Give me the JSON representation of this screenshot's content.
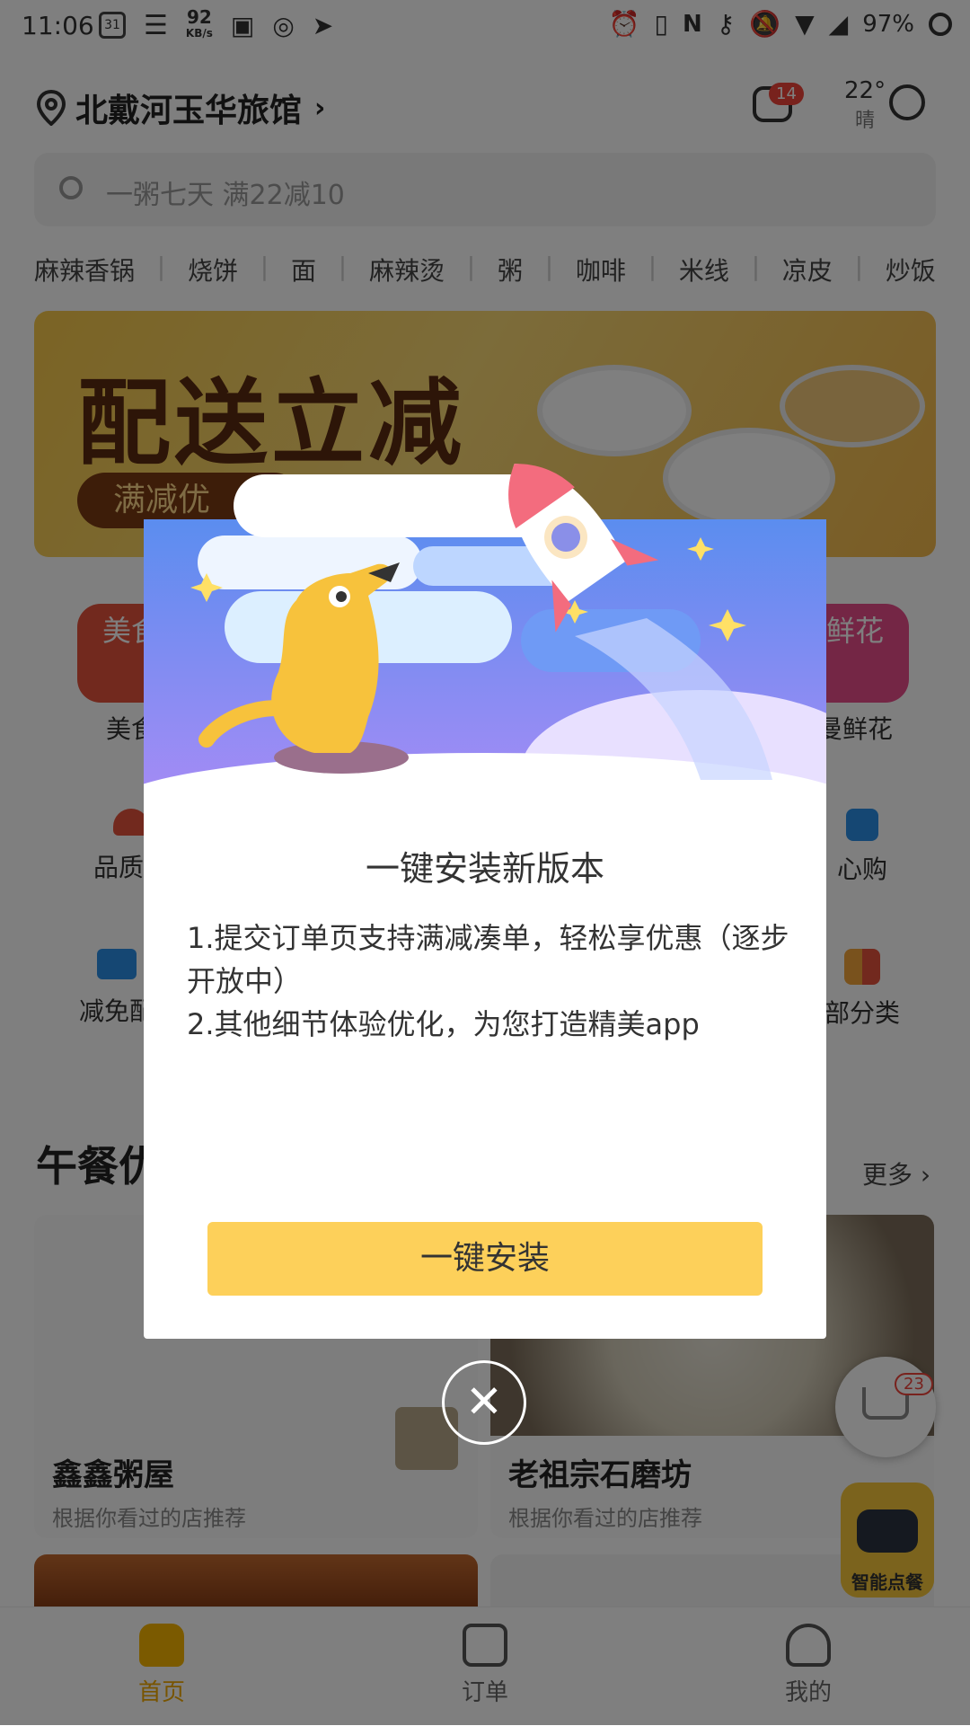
{
  "status_bar": {
    "time": "11:06",
    "calendar_day": "31",
    "net_speed": "92",
    "net_unit": "KB/s",
    "battery": "97%"
  },
  "header": {
    "location": "北戴河玉华旅馆",
    "chevron": "›",
    "message_badge": "14",
    "temperature": "22°",
    "weather": "晴"
  },
  "search": {
    "placeholder": "一粥七天 满22减10"
  },
  "categories": [
    "麻辣香锅",
    "烧饼",
    "面",
    "麻辣烫",
    "粥",
    "咖啡",
    "米线",
    "凉皮",
    "炒饭"
  ],
  "banner": {
    "headline": "配送立减",
    "pill_text": "满减优"
  },
  "features": {
    "row1_left_label": "美食",
    "row1_left_icon_text": "美食",
    "row1_right_label": "曼鲜花",
    "row1_right_icon_text": "鲜花",
    "row2_left_label": "品质午",
    "row2_right_label": "心购",
    "row3_left_label": "减免配",
    "row3_right_label": "部分类"
  },
  "section": {
    "title": "午餐优",
    "more": "更多",
    "more_chevron": "›",
    "cards": [
      {
        "name": "鑫鑫粥屋",
        "rec": "根据你看过的店推荐"
      },
      {
        "name": "老祖宗石磨坊",
        "rec": "根据你看过的店推荐"
      }
    ]
  },
  "cart": {
    "badge": "23"
  },
  "robot": {
    "label": "智能点餐"
  },
  "tabs": [
    {
      "label": "首页",
      "active": true
    },
    {
      "label": "订单",
      "active": false
    },
    {
      "label": "我的",
      "active": false
    }
  ],
  "dialog": {
    "title": "一键安装新版本",
    "line1": "1.提交订单页支持满减凑单，轻松享优惠（逐步开放中）",
    "line2": "2.其他细节体验优化，为您打造精美app",
    "button": "一键安装",
    "close": "✕"
  },
  "colors": {
    "accent": "#f7b500",
    "install_button": "#fdd05a",
    "badge_red": "#f0443a",
    "hero_blue": "#5b8def",
    "hero_purple": "#a78bf5"
  }
}
